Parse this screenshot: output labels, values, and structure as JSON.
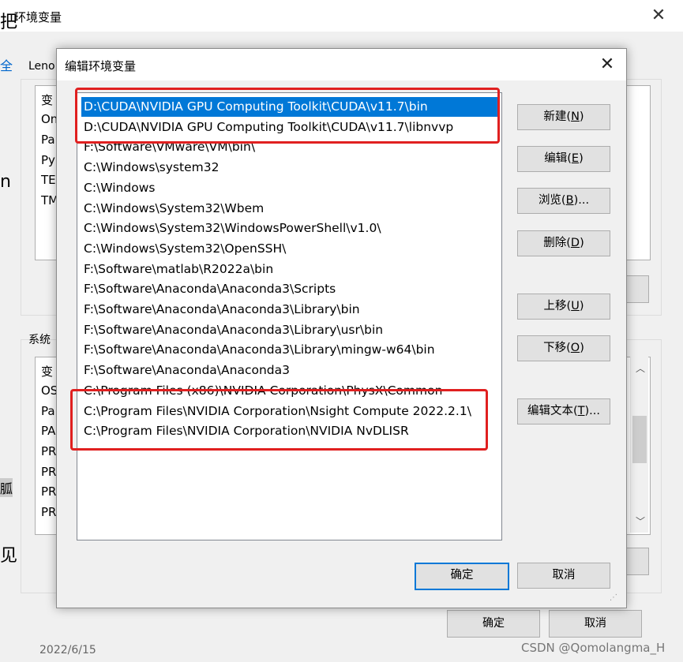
{
  "background_window": {
    "title": "环境变量",
    "close_glyph": "✕",
    "user_group_label": "Leno",
    "user_list_items": [
      "变",
      "On",
      "Pa",
      "Py",
      "TE",
      "TM"
    ],
    "system_group_label": "系统",
    "system_list_items": [
      "变",
      "OS",
      "Pa",
      "PA",
      "PR",
      "PR",
      "PR",
      "PR",
      "PR"
    ],
    "ok_label": "确定",
    "cancel_label": "取消",
    "left_edge_chars": [
      "把",
      "全",
      "n",
      "胍",
      "见"
    ],
    "bottom_text": "2022/6/15"
  },
  "dialog": {
    "title": "编辑环境变量",
    "close_glyph": "✕",
    "paths": [
      "D:\\CUDA\\NVIDIA GPU Computing Toolkit\\CUDA\\v11.7\\bin",
      "D:\\CUDA\\NVIDIA GPU Computing Toolkit\\CUDA\\v11.7\\libnvvp",
      "F:\\Software\\VMware\\VM\\bin\\",
      "C:\\Windows\\system32",
      "C:\\Windows",
      "C:\\Windows\\System32\\Wbem",
      "C:\\Windows\\System32\\WindowsPowerShell\\v1.0\\",
      "C:\\Windows\\System32\\OpenSSH\\",
      "F:\\Software\\matlab\\R2022a\\bin",
      "F:\\Software\\Anaconda\\Anaconda3\\Scripts",
      "F:\\Software\\Anaconda\\Anaconda3\\Library\\bin",
      "F:\\Software\\Anaconda\\Anaconda3\\Library\\usr\\bin",
      "F:\\Software\\Anaconda\\Anaconda3\\Library\\mingw-w64\\bin",
      "F:\\Software\\Anaconda\\Anaconda3",
      "C:\\Program Files (x86)\\NVIDIA Corporation\\PhysX\\Common",
      "C:\\Program Files\\NVIDIA Corporation\\Nsight Compute 2022.2.1\\",
      "C:\\Program Files\\NVIDIA Corporation\\NVIDIA NvDLISR"
    ],
    "selected_index": 0,
    "buttons": {
      "new": {
        "text": "新建(",
        "key": "N",
        "end": ")"
      },
      "edit": {
        "text": "编辑(",
        "key": "E",
        "end": ")"
      },
      "browse": {
        "text": "浏览(",
        "key": "B",
        "end": ")..."
      },
      "delete": {
        "text": "删除(",
        "key": "D",
        "end": ")"
      },
      "move_up": {
        "text": "上移(",
        "key": "U",
        "end": ")"
      },
      "move_down": {
        "text": "下移(",
        "key": "O",
        "end": ")"
      },
      "edit_text": {
        "text": "编辑文本(",
        "key": "T",
        "end": ")..."
      }
    },
    "ok_label": "确定",
    "cancel_label": "取消"
  },
  "highlight_color": "#e02020",
  "selection_color": "#0078d7",
  "watermark": "CSDN @Qomolangma_H"
}
